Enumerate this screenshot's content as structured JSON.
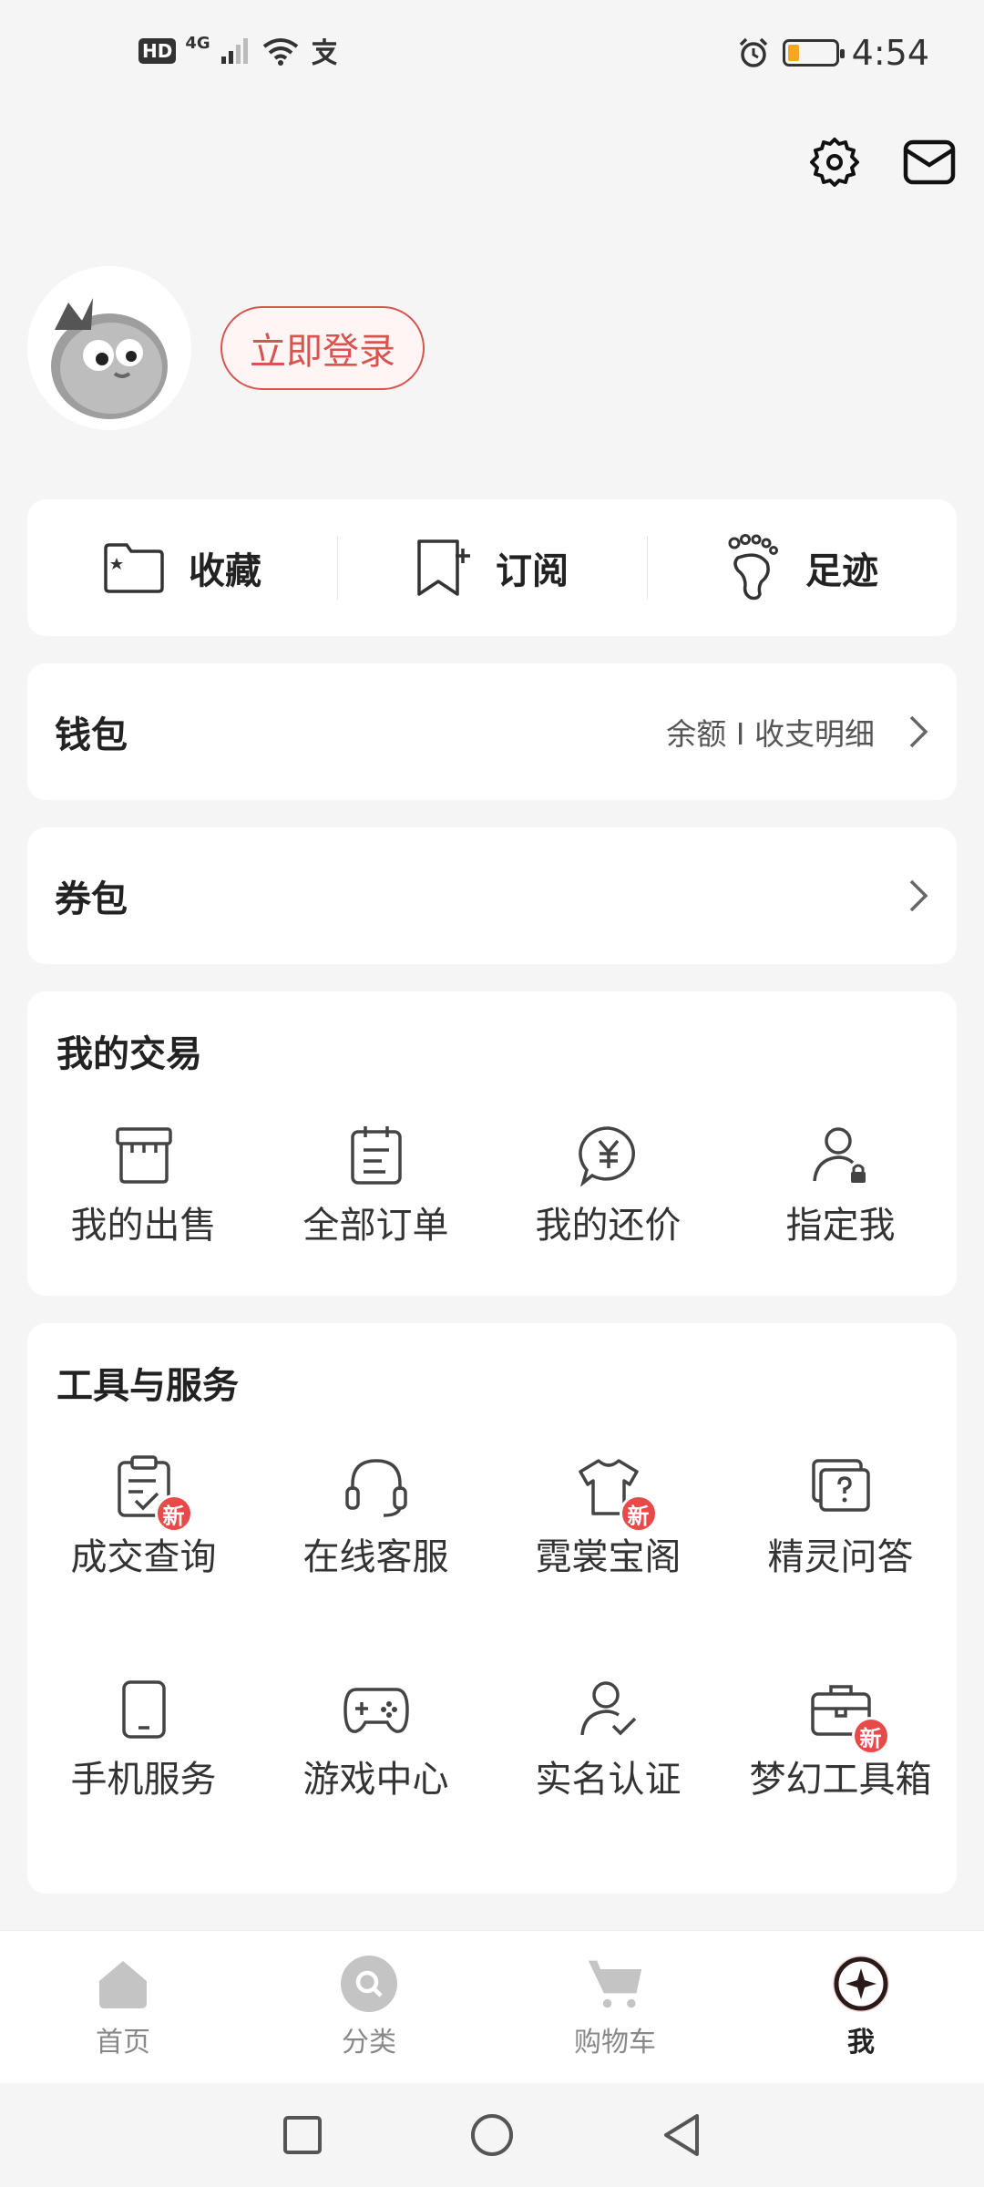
{
  "status_bar": {
    "left_badges": [
      "HD",
      "4G"
    ],
    "time": "4:54"
  },
  "profile": {
    "login_label": "立即登录"
  },
  "quick_links": [
    {
      "label": "收藏",
      "icon": "folder-star-icon"
    },
    {
      "label": "订阅",
      "icon": "bookmark-plus-icon"
    },
    {
      "label": "足迹",
      "icon": "footprint-icon"
    }
  ],
  "wallet": {
    "title": "钱包",
    "subtitle": "余额 I 收支明细"
  },
  "coupons": {
    "title": "券包"
  },
  "trade": {
    "title": "我的交易",
    "items": [
      {
        "label": "我的出售",
        "icon": "store-icon"
      },
      {
        "label": "全部订单",
        "icon": "order-list-icon"
      },
      {
        "label": "我的还价",
        "icon": "yuan-bubble-icon"
      },
      {
        "label": "指定我",
        "icon": "user-lock-icon"
      }
    ]
  },
  "tools": {
    "title": "工具与服务",
    "badge_label": "新",
    "row1": [
      {
        "label": "成交查询",
        "icon": "clipboard-check-icon",
        "badge": true
      },
      {
        "label": "在线客服",
        "icon": "headset-icon",
        "badge": false
      },
      {
        "label": "霓裳宝阁",
        "icon": "tshirt-icon",
        "badge": true
      },
      {
        "label": "精灵问答",
        "icon": "question-chat-icon",
        "badge": false
      }
    ],
    "row2": [
      {
        "label": "手机服务",
        "icon": "phone-icon",
        "badge": false
      },
      {
        "label": "游戏中心",
        "icon": "gamepad-icon",
        "badge": false
      },
      {
        "label": "实名认证",
        "icon": "user-verify-icon",
        "badge": false
      },
      {
        "label": "梦幻工具箱",
        "icon": "toolbox-icon",
        "badge": true
      }
    ]
  },
  "tabs": [
    {
      "label": "首页",
      "icon": "home-icon",
      "active": false
    },
    {
      "label": "分类",
      "icon": "search-icon",
      "active": false
    },
    {
      "label": "购物车",
      "icon": "cart-icon",
      "active": false
    },
    {
      "label": "我",
      "icon": "profile-compass-icon",
      "active": true
    }
  ],
  "colors": {
    "accent": "#d9534f",
    "badge": "#e84a4a",
    "background": "#f5f5f5"
  }
}
